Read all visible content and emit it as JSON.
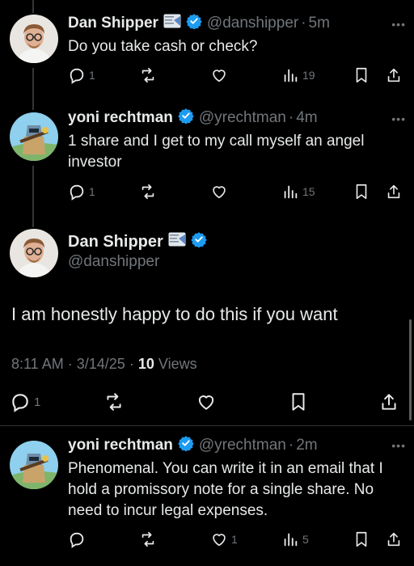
{
  "tweets": [
    {
      "name": "Dan Shipper",
      "handle": "@danshipper",
      "time": "5m",
      "text": "Do you take cash or check?",
      "replies": "1",
      "retweets": "",
      "likes": "",
      "views": "19"
    },
    {
      "name": "yoni rechtman",
      "handle": "@yrechtman",
      "time": "4m",
      "text": "1 share and I get to my call myself an angel investor",
      "replies": "1",
      "retweets": "",
      "likes": "",
      "views": "15"
    }
  ],
  "focused": {
    "name": "Dan Shipper",
    "handle": "@danshipper",
    "text": "I am honestly happy to do this if you want",
    "time": "8:11 AM",
    "date": "3/14/25",
    "views_count": "10",
    "views_label": "Views",
    "replies": "1"
  },
  "reply": {
    "name": "yoni rechtman",
    "handle": "@yrechtman",
    "time": "2m",
    "text": "Phenomenal. You can write it in an email that I hold a promissory note for a single share. No need to incur legal expenses.",
    "replies": "",
    "likes": "1",
    "views": "5"
  },
  "dot": "·",
  "more": "•••",
  "colors": {
    "verified": "#1d9bf0",
    "muted": "#71767b",
    "text": "#e7e9ea",
    "bg": "#000000"
  }
}
